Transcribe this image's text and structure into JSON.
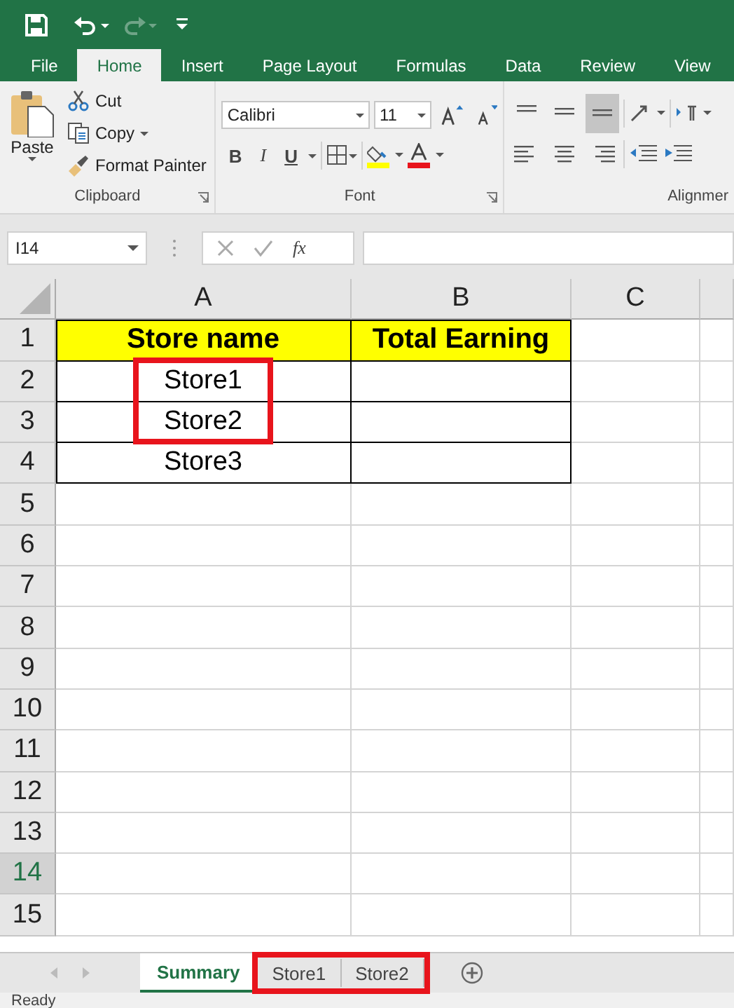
{
  "quick_access": {
    "undo_enabled": true,
    "redo_enabled": false
  },
  "ribbon_tabs": [
    {
      "label": "File",
      "selected": false
    },
    {
      "label": "Home",
      "selected": true
    },
    {
      "label": "Insert",
      "selected": false
    },
    {
      "label": "Page Layout",
      "selected": false
    },
    {
      "label": "Formulas",
      "selected": false
    },
    {
      "label": "Data",
      "selected": false
    },
    {
      "label": "Review",
      "selected": false
    },
    {
      "label": "View",
      "selected": false
    }
  ],
  "clipboard": {
    "paste": "Paste",
    "cut": "Cut",
    "copy": "Copy",
    "format_painter": "Format Painter",
    "label": "Clipboard"
  },
  "font": {
    "name": "Calibri",
    "size": "11",
    "bold": "B",
    "italic": "I",
    "underline": "U",
    "label": "Font"
  },
  "alignment": {
    "label": "Alignmer"
  },
  "formula_bar": {
    "name_box": "I14",
    "function_label": "fx"
  },
  "columns": [
    {
      "label": "A",
      "selected": false
    },
    {
      "label": "B",
      "selected": false
    },
    {
      "label": "C",
      "selected": false
    }
  ],
  "rows": [
    {
      "number": "1",
      "selected": false,
      "cells": [
        {
          "kind": "header",
          "text": "Store name"
        },
        {
          "kind": "header",
          "text": "Total Earning"
        }
      ]
    },
    {
      "number": "2",
      "selected": false,
      "cells": [
        {
          "kind": "data",
          "text": "Store1",
          "marked": true
        },
        {
          "kind": "data"
        }
      ]
    },
    {
      "number": "3",
      "selected": false,
      "cells": [
        {
          "kind": "data",
          "text": "Store2",
          "marked": true
        },
        {
          "kind": "data"
        }
      ]
    },
    {
      "number": "4",
      "selected": false,
      "cells": [
        {
          "kind": "data",
          "text": "Store3",
          "marked": false
        },
        {
          "kind": "data"
        }
      ]
    },
    {
      "number": "5",
      "selected": false,
      "cells": []
    },
    {
      "number": "6",
      "selected": false,
      "cells": []
    },
    {
      "number": "7",
      "selected": false,
      "cells": []
    },
    {
      "number": "8",
      "selected": false,
      "cells": []
    },
    {
      "number": "9",
      "selected": false,
      "cells": []
    },
    {
      "number": "10",
      "selected": false,
      "cells": []
    },
    {
      "number": "11",
      "selected": false,
      "cells": []
    },
    {
      "number": "12",
      "selected": false,
      "cells": []
    },
    {
      "number": "13",
      "selected": false,
      "cells": []
    },
    {
      "number": "14",
      "selected": true,
      "cells": []
    },
    {
      "number": "15",
      "selected": false,
      "cells": []
    }
  ],
  "sheet_tabs": [
    {
      "label": "Summary",
      "selected": true,
      "marked": false
    },
    {
      "label": "Store1",
      "selected": false,
      "marked": true
    },
    {
      "label": "Store2",
      "selected": false,
      "marked": true
    }
  ],
  "status_bar": {
    "text": "Ready"
  }
}
